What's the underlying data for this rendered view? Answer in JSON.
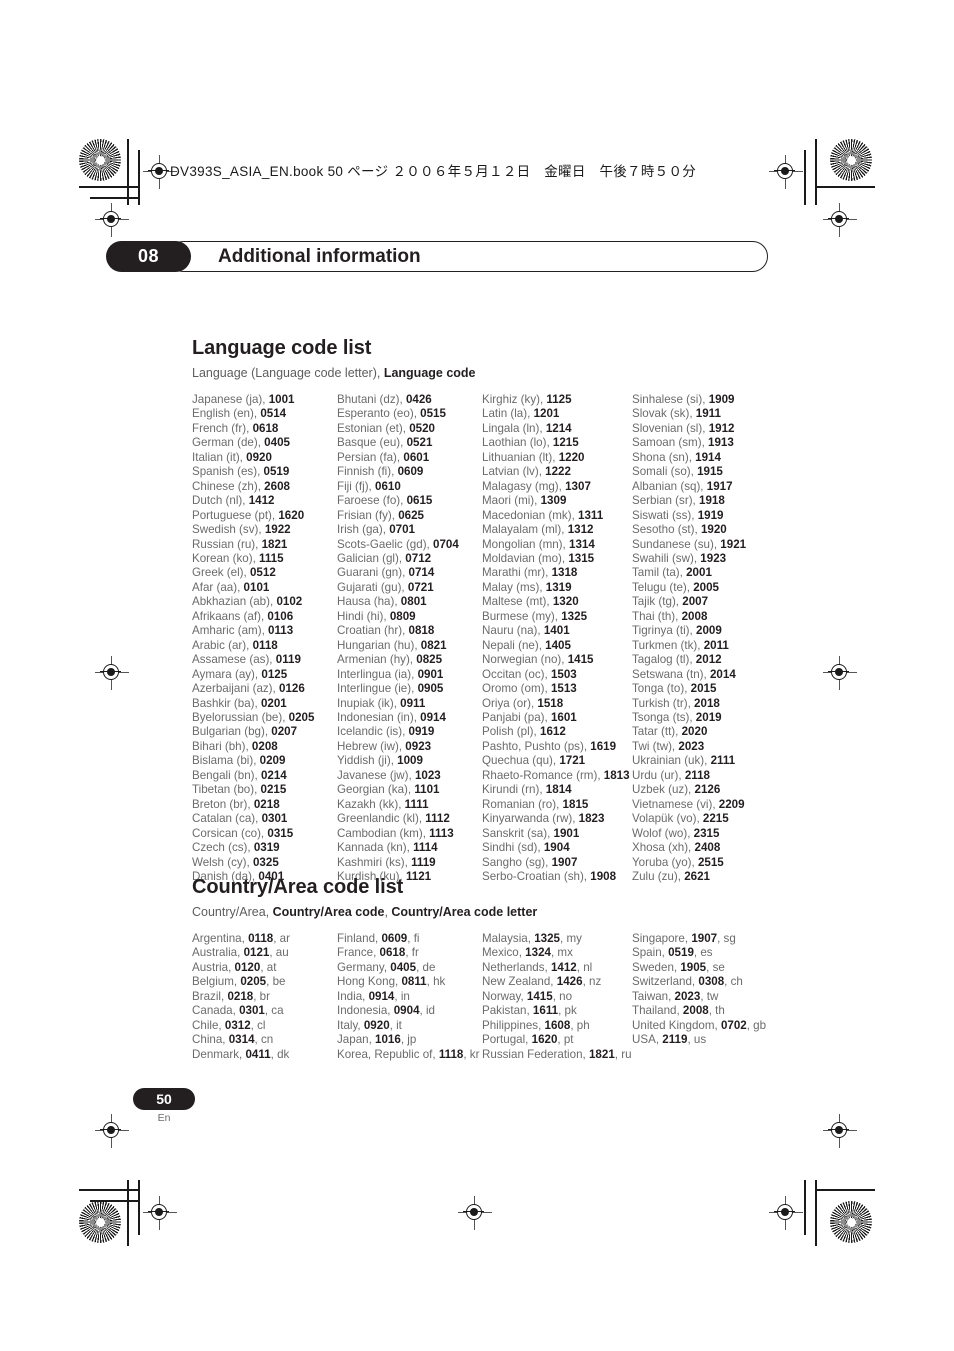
{
  "header": {
    "file_line": "DV393S_ASIA_EN.book  50 ページ  ２００６年５月１２日　金曜日　午後７時５０分"
  },
  "chapter": {
    "number": "08",
    "title": "Additional information"
  },
  "language_section": {
    "title": "Language code list",
    "legend_plain": "Language (Language code letter), ",
    "legend_bold": "Language code",
    "columns": [
      [
        "Japanese (ja), |1001",
        "English (en), |0514",
        "French (fr), |0618",
        "German (de), |0405",
        "Italian (it), |0920",
        "Spanish (es), |0519",
        "Chinese (zh), |2608",
        "Dutch (nl), |1412",
        "Portuguese (pt), |1620",
        "Swedish (sv), |1922",
        "Russian (ru), |1821",
        "Korean (ko), |1115",
        "Greek (el), |0512",
        "Afar (aa), |0101",
        "Abkhazian (ab), |0102",
        "Afrikaans (af), |0106",
        "Amharic (am), |0113",
        "Arabic (ar), |0118",
        "Assamese (as), |0119",
        "Aymara (ay), |0125",
        "Azerbaijani (az), |0126",
        "Bashkir (ba), |0201",
        "Byelorussian (be), |0205",
        "Bulgarian (bg), |0207",
        "Bihari (bh), |0208",
        "Bislama (bi), |0209",
        "Bengali (bn), |0214",
        "Tibetan (bo), |0215",
        "Breton (br), |0218",
        "Catalan (ca), |0301",
        "Corsican (co), |0315",
        "Czech (cs), |0319",
        "Welsh (cy), |0325",
        "Danish (da), |0401"
      ],
      [
        "Bhutani (dz), |0426",
        "Esperanto (eo), |0515",
        "Estonian (et), |0520",
        "Basque (eu), |0521",
        "Persian (fa), |0601",
        "Finnish (fi), |0609",
        "Fiji (fj), |0610",
        "Faroese (fo), |0615",
        "Frisian (fy), |0625",
        "Irish (ga), |0701",
        "Scots-Gaelic (gd), |0704",
        "Galician (gl), |0712",
        "Guarani (gn), |0714",
        "Gujarati (gu), |0721",
        "Hausa (ha), |0801",
        "Hindi (hi), |0809",
        "Croatian (hr), |0818",
        "Hungarian (hu), |0821",
        "Armenian (hy), |0825",
        "Interlingua (ia), |0901",
        "Interlingue (ie), |0905",
        "Inupiak (ik), |0911",
        "Indonesian (in), |0914",
        "Icelandic (is), |0919",
        "Hebrew (iw), |0923",
        "Yiddish (ji), |1009",
        "Javanese (jw), |1023",
        "Georgian (ka), |1101",
        "Kazakh (kk), |1111",
        "Greenlandic  (kl), |1112",
        "Cambodian (km), |1113",
        "Kannada (kn), |1114",
        "Kashmiri (ks), |1119",
        "Kurdish (ku), |1121"
      ],
      [
        "Kirghiz (ky), |1125",
        "Latin (la), |1201",
        "Lingala (ln), |1214",
        "Laothian (lo), |1215",
        "Lithuanian (lt), |1220",
        "Latvian (lv), |1222",
        "Malagasy (mg), |1307",
        "Maori (mi), |1309",
        "Macedonian (mk), |1311",
        "Malayalam  (ml), |1312",
        "Mongolian (mn), |1314",
        "Moldavian (mo), |1315",
        "Marathi (mr), |1318",
        "Malay  (ms), |1319",
        "Maltese (mt), |1320",
        "Burmese (my), |1325",
        "Nauru (na), |1401",
        "Nepali (ne), |1405",
        "Norwegian (no), |1415",
        "Occitan (oc), |1503",
        "Oromo (om), |1513",
        "Oriya (or), |1518",
        "Panjabi (pa), |1601",
        "Polish (pl), |1612",
        "Pashto, Pushto (ps), |1619",
        "Quechua (qu), |1721",
        "Rhaeto-Romance (rm), |1813",
        "Kirundi (rn), |1814",
        "Romanian (ro), |1815",
        "Kinyarwanda (rw), |1823",
        "Sanskrit (sa), |1901",
        "Sindhi (sd), |1904",
        "Sangho (sg), |1907",
        "Serbo-Croatian (sh), |1908"
      ],
      [
        "Sinhalese (si), |1909",
        "Slovak (sk), |1911",
        "Slovenian (sl), |1912",
        "Samoan (sm), |1913",
        "Shona (sn), |1914",
        "Somali (so), |1915",
        "Albanian (sq), |1917",
        "Serbian (sr), |1918",
        "Siswati (ss), |1919",
        "Sesotho (st), |1920",
        "Sundanese (su), |1921",
        "Swahili (sw), |1923",
        "Tamil (ta), |2001",
        "Telugu (te), |2005",
        "Tajik (tg), |2007",
        "Thai (th), |2008",
        "Tigrinya (ti), |2009",
        "Turkmen (tk), |2011",
        "Tagalog (tl), |2012",
        "Setswana (tn), |2014",
        "Tonga (to), |2015",
        "Turkish (tr), |2018",
        "Tsonga (ts), |2019",
        "Tatar (tt), |2020",
        "Twi (tw), |2023",
        "Ukrainian (uk), |2111",
        "Urdu (ur), |2118",
        "Uzbek (uz), |2126",
        "Vietnamese (vi), |2209",
        "Volapük (vo), |2215",
        "Wolof (wo), |2315",
        "Xhosa (xh), |2408",
        "Yoruba (yo), |2515",
        "Zulu (zu), |2621"
      ]
    ]
  },
  "country_section": {
    "title": "Country/Area code list",
    "legend_plain": "Country/Area, ",
    "legend_bold": "Country/Area code",
    "legend_plain2": ", ",
    "legend_bold2": "Country/Area code letter",
    "columns": [
      [
        "Argentina, |0118|, ar",
        "Australia, |0121|, au",
        "Austria, |0120|, at",
        "Belgium, |0205|, be",
        "Brazil, |0218|, br",
        "Canada, |0301|, ca",
        "Chile, |0312|, cl",
        "China, |0314|, cn",
        "Denmark, |0411|, dk"
      ],
      [
        "Finland, |0609|, fi",
        "France, |0618|, fr",
        "Germany, |0405|, de",
        "Hong Kong, |0811|, hk",
        "India, |0914|, in",
        "Indonesia, |0904|, id",
        "Italy, |0920|, it",
        "Japan, |1016|, jp",
        "Korea, Republic of, |1118|, kr"
      ],
      [
        "Malaysia, |1325|, my",
        "Mexico, |1324|, mx",
        "Netherlands, |1412|, nl",
        "New Zealand, |1426|, nz",
        "Norway, |1415|, no",
        "Pakistan, |1611|, pk",
        "Philippines, |1608|, ph",
        "Portugal, |1620|, pt",
        "Russian Federation, |1821|, ru"
      ],
      [
        "Singapore, |1907|, sg",
        "Spain, |0519|, es",
        "Sweden, |1905|, se",
        "Switzerland, |0308|, ch",
        "Taiwan, |2023|, tw",
        "Thailand, |2008|, th",
        "United Kingdom, |0702|, gb",
        "USA, |2119|, us"
      ]
    ]
  },
  "footer": {
    "page_number": "50",
    "language_code": "En"
  }
}
